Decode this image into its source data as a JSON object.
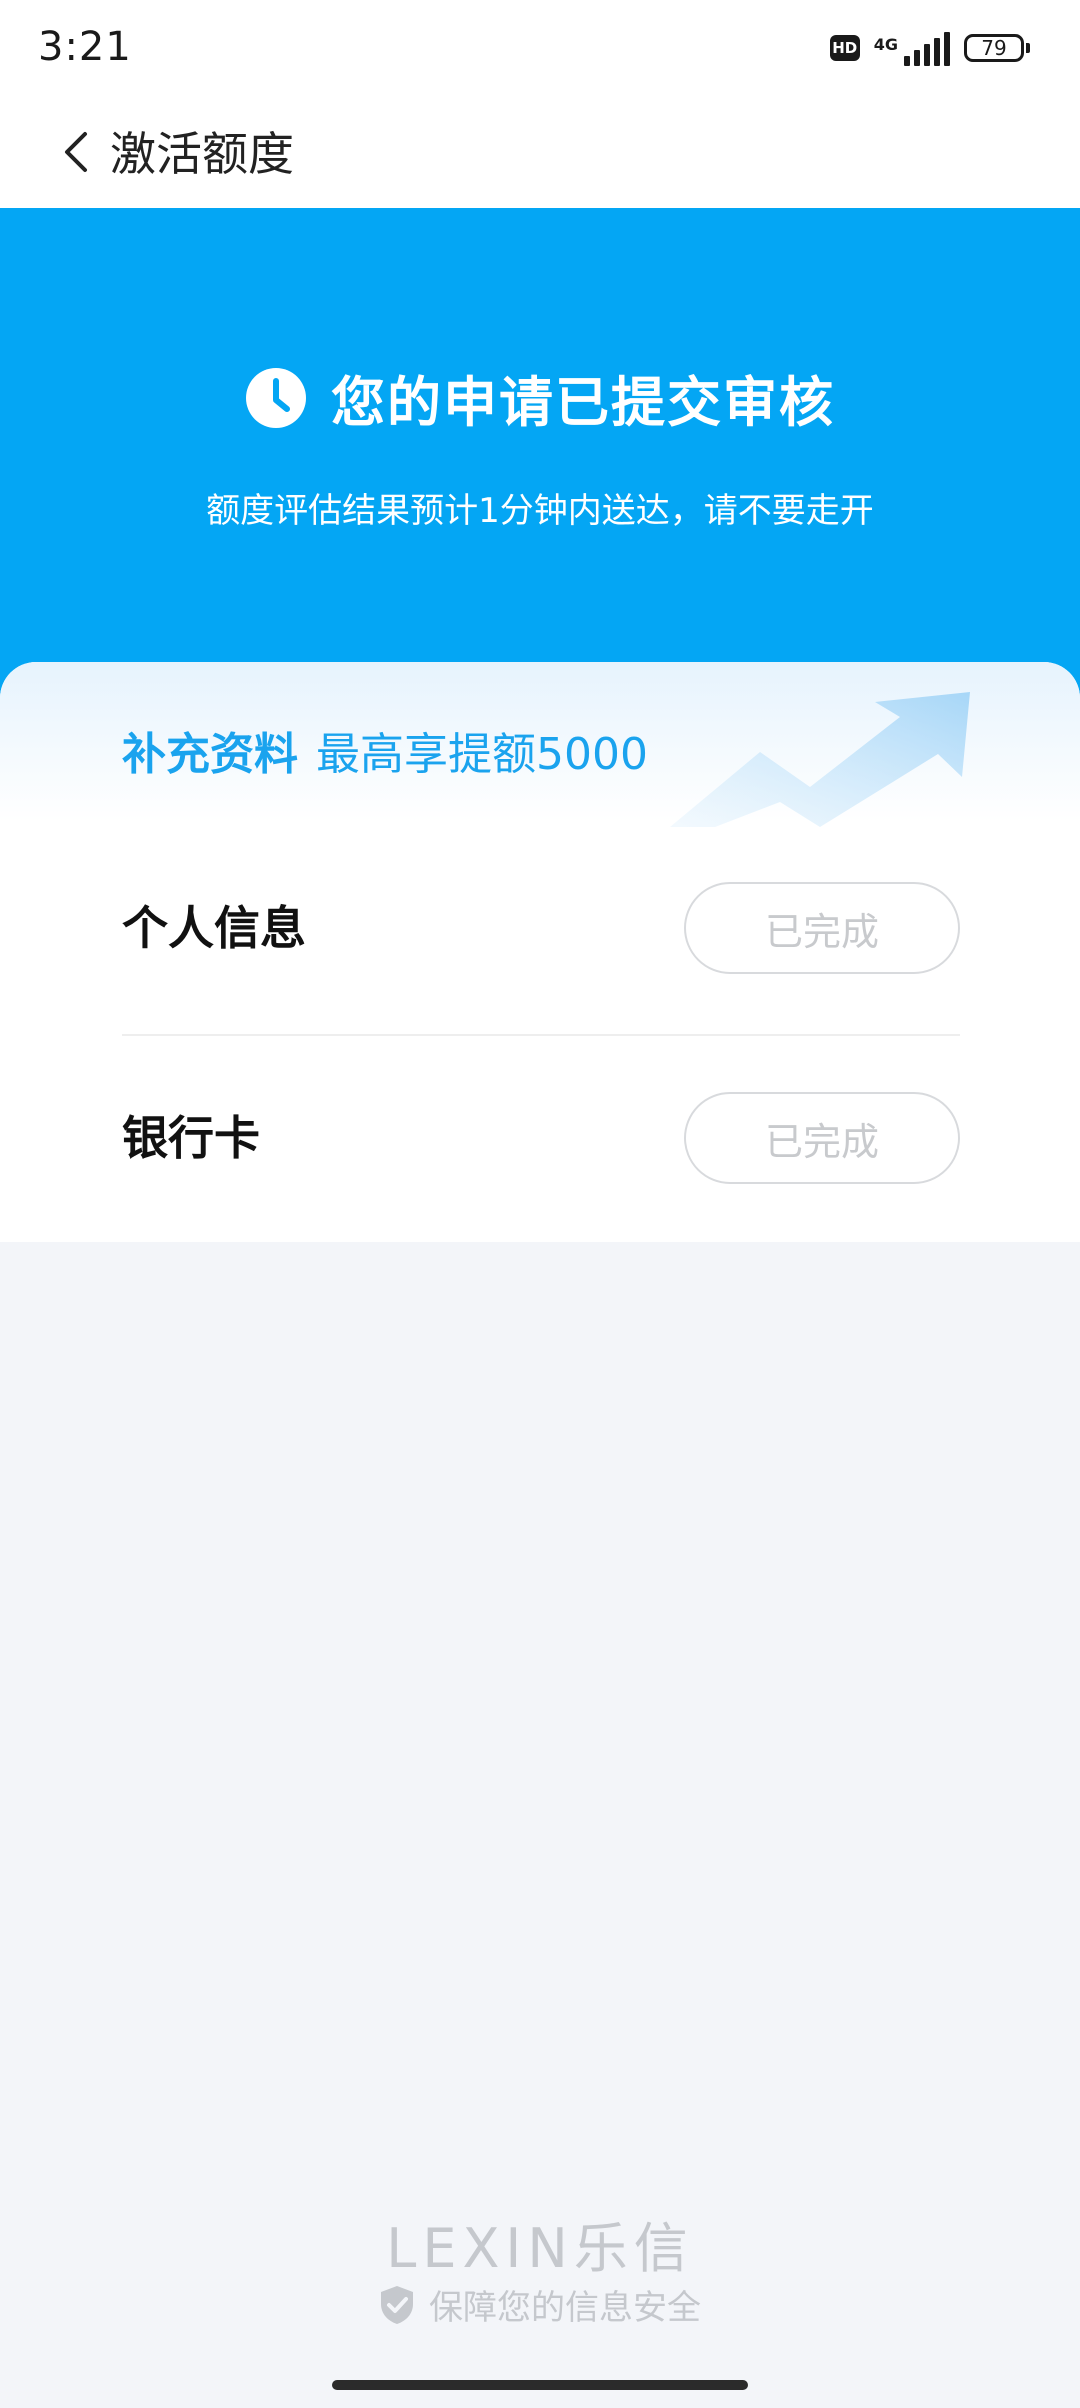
{
  "status_bar": {
    "time": "3:21",
    "hd": "HD",
    "network": "4G",
    "battery": "79"
  },
  "nav": {
    "title": "激活额度",
    "back_icon": "chevron-left-icon"
  },
  "banner": {
    "icon": "clock-icon",
    "title": "您的申请已提交审核",
    "subtitle": "额度评估结果预计1分钟内送达，请不要走开",
    "color": "#04a6f4"
  },
  "card": {
    "promo_bold": "补充资料",
    "promo_text": "最高享提额5000",
    "rows": [
      {
        "label": "个人信息",
        "status": "已完成"
      },
      {
        "label": "银行卡",
        "status": "已完成"
      }
    ]
  },
  "footer": {
    "logo": "LEXIN乐信",
    "security_text": "保障您的信息安全",
    "icon": "shield-check-icon"
  }
}
